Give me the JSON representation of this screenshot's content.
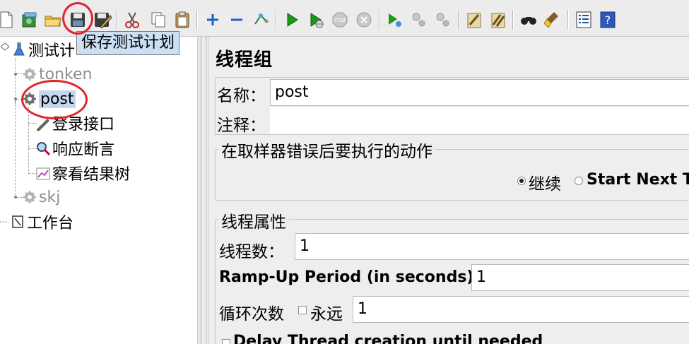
{
  "toolbar": {
    "tooltip": "保存测试计划",
    "buttons": [
      {
        "name": "new-plan-icon"
      },
      {
        "name": "templates-icon"
      },
      {
        "name": "open-icon"
      },
      {
        "name": "save-icon"
      },
      {
        "name": "save-as-icon"
      },
      {
        "name": "cut-icon"
      },
      {
        "name": "copy-icon"
      },
      {
        "name": "paste-icon"
      },
      {
        "name": "expand-all-icon"
      },
      {
        "name": "collapse-all-icon"
      },
      {
        "name": "toggle-icon"
      },
      {
        "name": "start-icon"
      },
      {
        "name": "start-no-pause-icon"
      },
      {
        "name": "stop-icon"
      },
      {
        "name": "shutdown-icon"
      },
      {
        "name": "remote-start-icon"
      },
      {
        "name": "remote-stop-icon"
      },
      {
        "name": "remote-shutdown-icon"
      },
      {
        "name": "clear-icon"
      },
      {
        "name": "clear-all-icon"
      },
      {
        "name": "search-icon"
      },
      {
        "name": "reset-search-icon"
      },
      {
        "name": "function-helper-icon"
      },
      {
        "name": "help-icon"
      }
    ]
  },
  "tree": {
    "root": "测试计",
    "thread_groups": [
      {
        "label": "tonken",
        "enabled": false
      },
      {
        "label": "post",
        "enabled": true,
        "selected": true
      },
      {
        "label": "skj",
        "enabled": false
      }
    ],
    "children": [
      "登录接口",
      "响应断言",
      "察看结果树"
    ],
    "workbench": "工作台"
  },
  "panel": {
    "title": "线程组",
    "name_label": "名称：",
    "name_value": "post",
    "comment_label": "注释：",
    "comment_value": "",
    "error_action": {
      "legend": "在取样器错误后要执行的动作",
      "continue_label": "继续",
      "start_next_label": "Start Next Th"
    },
    "thread_props": {
      "legend": "线程属性",
      "threads_label": "线程数：",
      "threads_value": "1",
      "rampup_label": "Ramp-Up Period (in seconds):",
      "rampup_value": "1",
      "loop_label": "循环次数",
      "forever_label": "永远",
      "loop_value": "1",
      "delay_label": "Delay Thread creation until needed"
    }
  }
}
